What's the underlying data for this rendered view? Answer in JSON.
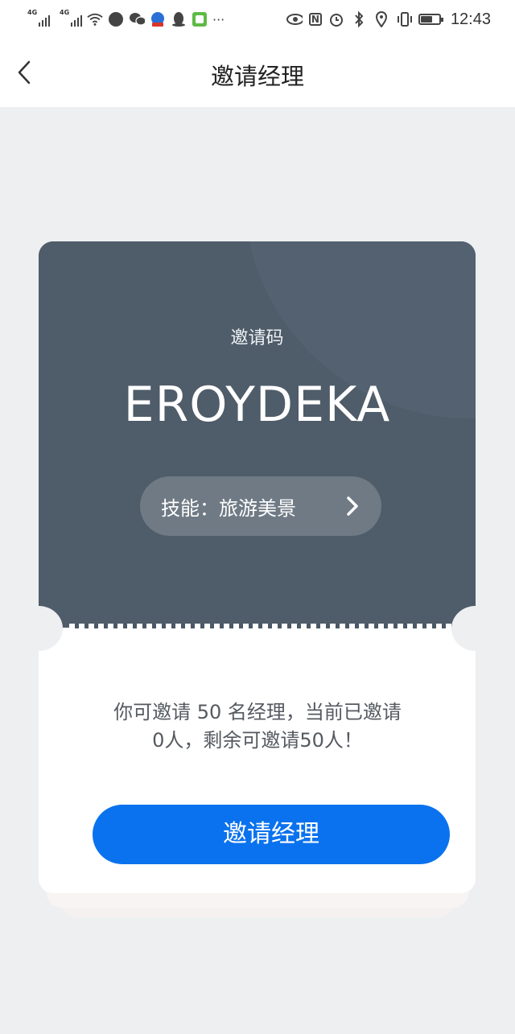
{
  "status_bar": {
    "signal_1_label": "4G",
    "signal_2_label": "4G",
    "time": "12:43",
    "battery_level": 0.65,
    "icons_left": [
      "signal-4g-icon",
      "signal-4g-icon",
      "wifi-icon",
      "app-circle-icon",
      "wechat-icon",
      "baidu-icon",
      "qq-icon",
      "green-app-icon",
      "more-dots-icon"
    ],
    "icons_right": [
      "eye-icon",
      "nfc-icon",
      "alarm-icon",
      "bluetooth-icon",
      "location-icon",
      "vibrate-icon",
      "battery-icon"
    ],
    "more_dots": "···",
    "nfc_letter": "N"
  },
  "nav": {
    "title": "邀请经理"
  },
  "card": {
    "code_label": "邀请码",
    "code": "EROYDEKA",
    "skill_text": "技能：旅游美景"
  },
  "description": {
    "line1": "你可邀请 50 名经理，当前已邀请",
    "line2": "0人，剩余可邀请50人！"
  },
  "action": {
    "invite_button_label": "邀请经理"
  },
  "colors": {
    "card_dark": "#4b5866",
    "primary_button": "#0a72ee",
    "page_background": "#eeeff1"
  }
}
